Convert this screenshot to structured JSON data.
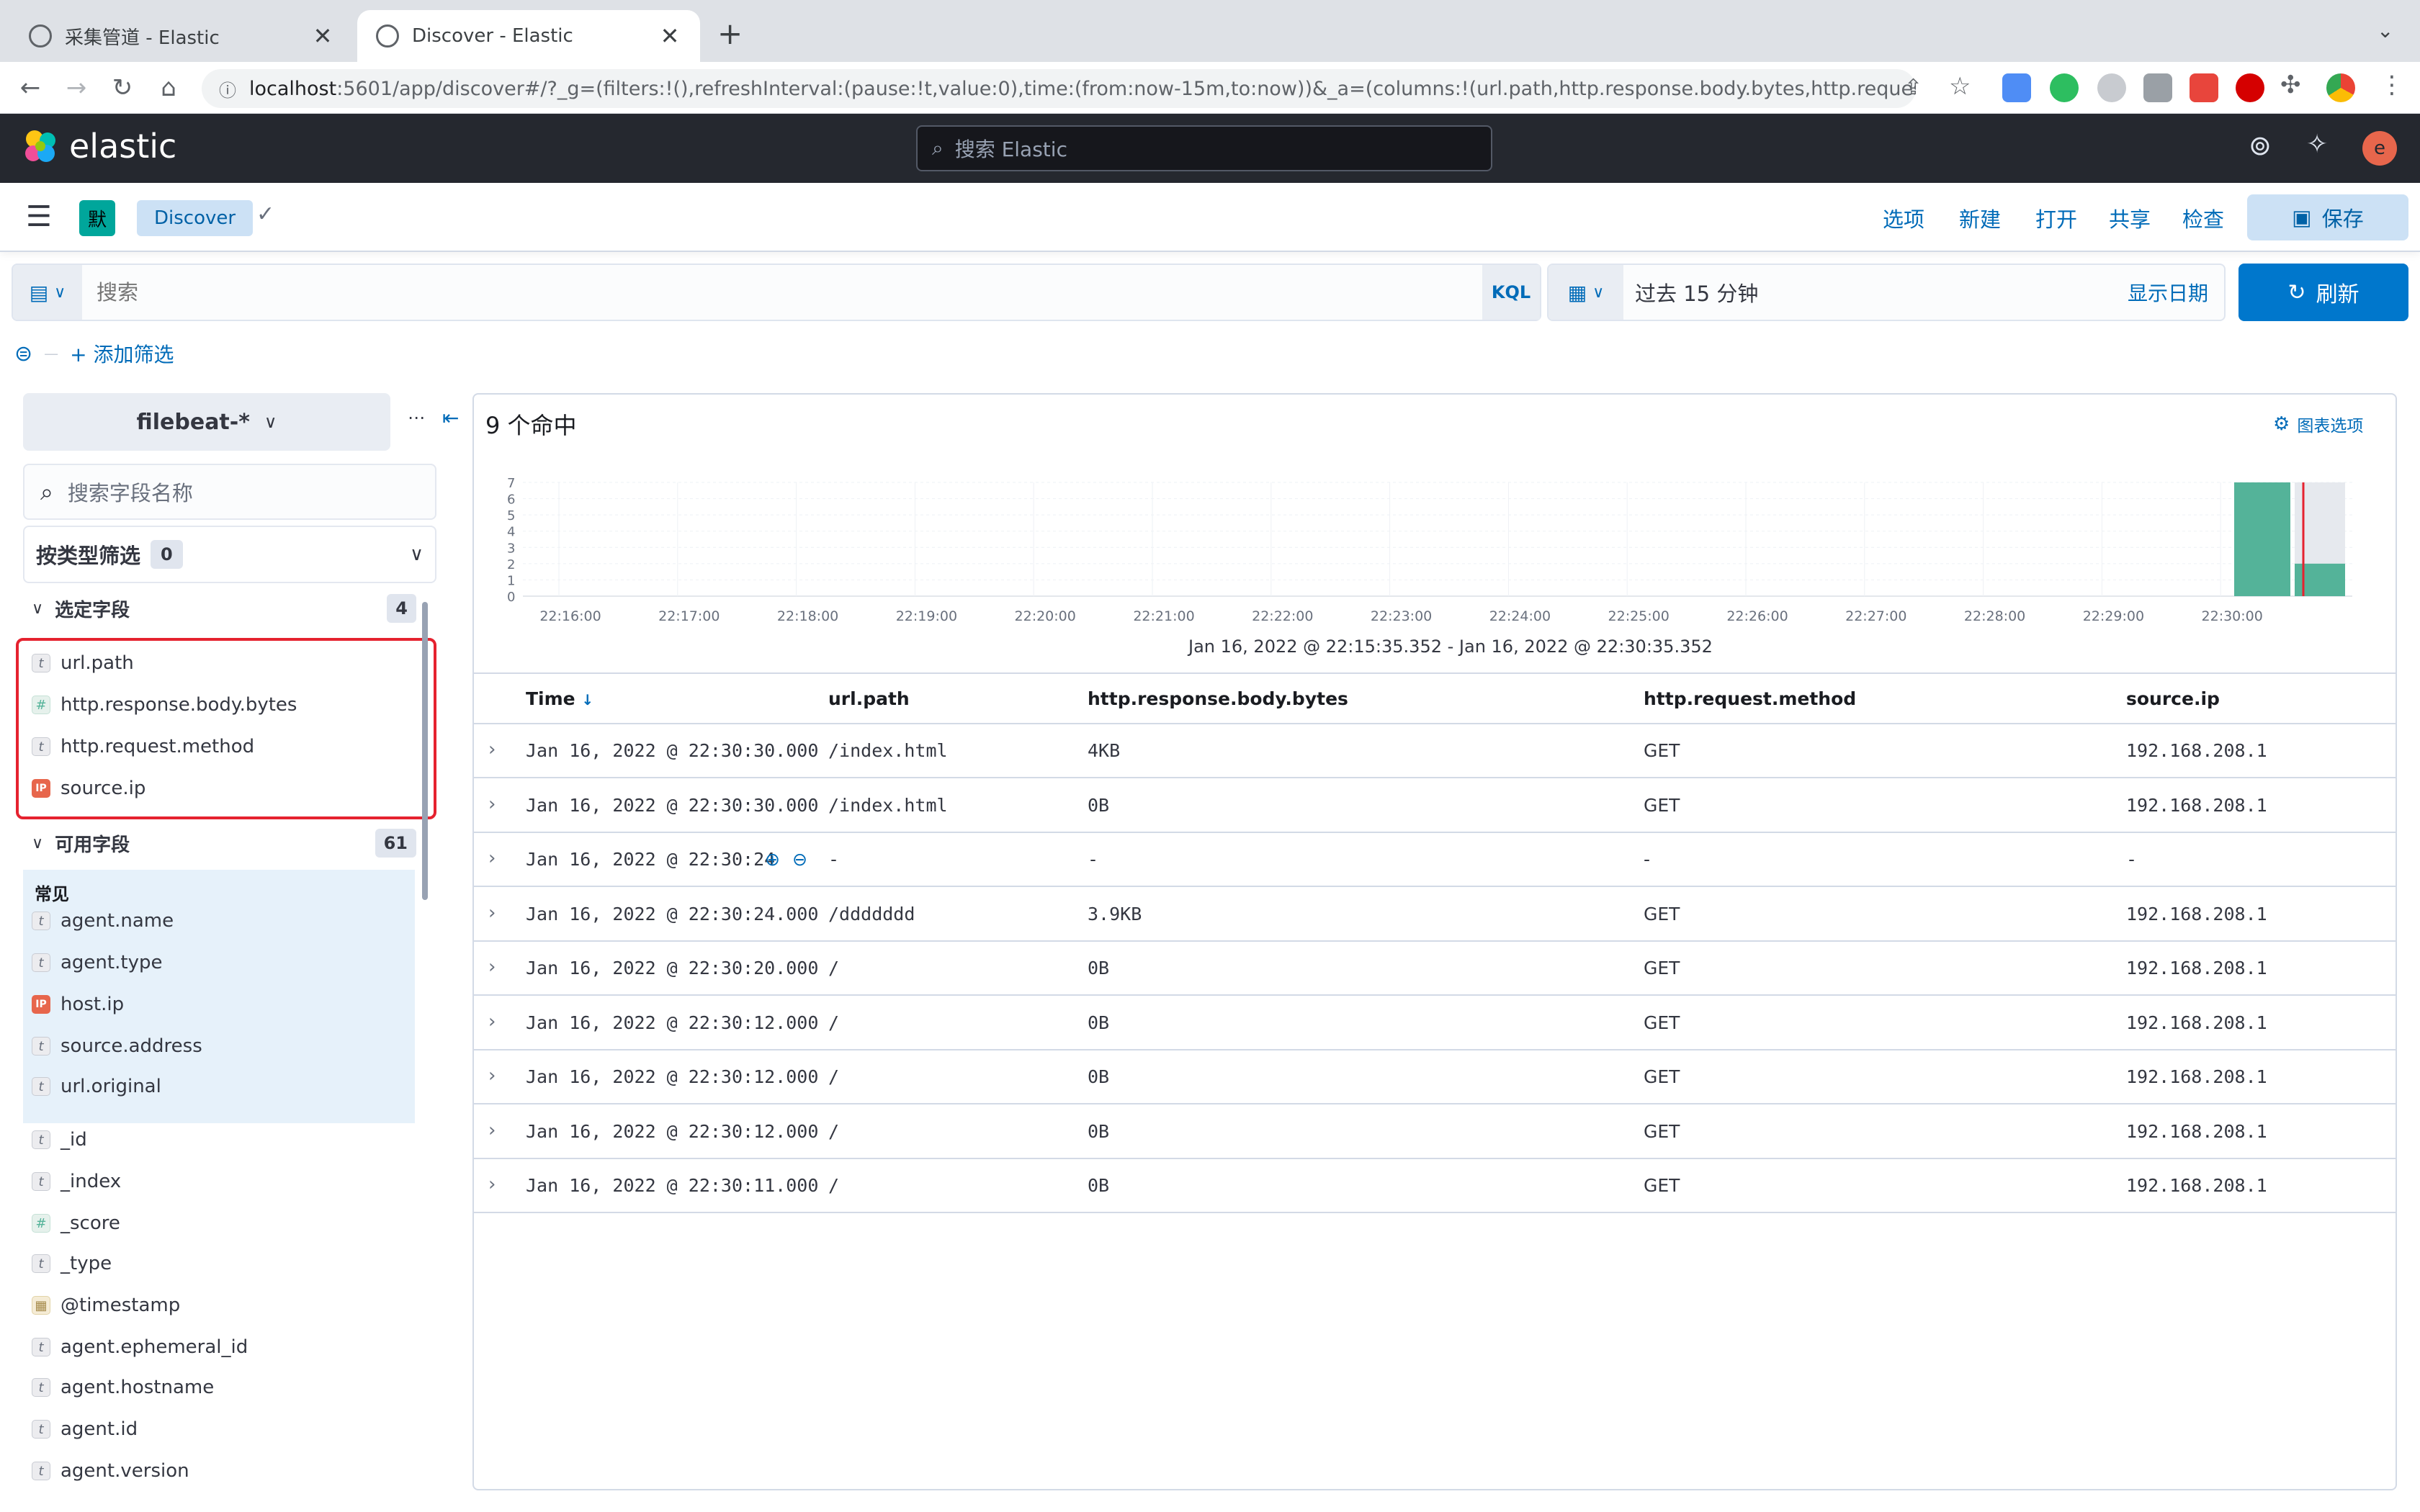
{
  "browser": {
    "tabs": [
      {
        "title": "采集管道 - Elastic",
        "active": false
      },
      {
        "title": "Discover - Elastic",
        "active": true
      }
    ],
    "url_host": "localhost",
    "url_rest": ":5601/app/discover#/?_g=(filters:!(),refreshInterval:(pause:!t,value:0),time:(from:now-15m,to:now))&_a=(columns:!(url.path,http.response.body.bytes,http.reques..."
  },
  "kibana": {
    "logo_text": "elastic",
    "search_placeholder": "搜索 Elastic",
    "avatar_letter": "e"
  },
  "toolbar": {
    "space_letter": "默",
    "breadcrumb": "Discover",
    "links": [
      "选项",
      "新建",
      "打开",
      "共享",
      "检查"
    ],
    "save_label": "保存"
  },
  "query": {
    "placeholder": "搜索",
    "language": "KQL",
    "time_label": "过去 15 分钟",
    "show_dates": "显示日期",
    "refresh_label": "刷新",
    "add_filter": "+ 添加筛选"
  },
  "sidebar": {
    "index_pattern": "filebeat-*",
    "field_search_placeholder": "搜索字段名称",
    "type_filter_label": "按类型筛选",
    "type_filter_count": "0",
    "selected_title": "选定字段",
    "selected_count": "4",
    "selected_fields": [
      {
        "name": "url.path",
        "type": "t"
      },
      {
        "name": "http.response.body.bytes",
        "type": "#"
      },
      {
        "name": "http.request.method",
        "type": "t"
      },
      {
        "name": "source.ip",
        "type": "IP"
      }
    ],
    "available_title": "可用字段",
    "available_count": "61",
    "common_title": "常见",
    "common_fields": [
      {
        "name": "agent.name",
        "type": "t"
      },
      {
        "name": "agent.type",
        "type": "t"
      },
      {
        "name": "host.ip",
        "type": "IP"
      },
      {
        "name": "source.address",
        "type": "t"
      },
      {
        "name": "url.original",
        "type": "t"
      }
    ],
    "other_fields": [
      {
        "name": "_id",
        "type": "t"
      },
      {
        "name": "_index",
        "type": "t"
      },
      {
        "name": "_score",
        "type": "#"
      },
      {
        "name": "_type",
        "type": "t"
      },
      {
        "name": "@timestamp",
        "type": "date"
      },
      {
        "name": "agent.ephemeral_id",
        "type": "t"
      },
      {
        "name": "agent.hostname",
        "type": "t"
      },
      {
        "name": "agent.id",
        "type": "t"
      },
      {
        "name": "agent.version",
        "type": "t"
      }
    ]
  },
  "results": {
    "hits_label": "9 个命中",
    "chart_options_label": "图表选项",
    "time_range": "Jan 16, 2022 @ 22:15:35.352 - Jan 16, 2022 @ 22:30:35.352",
    "columns": [
      "Time",
      "url.path",
      "http.response.body.bytes",
      "http.request.method",
      "source.ip"
    ],
    "rows": [
      [
        "Jan 16, 2022 @ 22:30:30.000",
        "/index.html",
        "4KB",
        "GET",
        "192.168.208.1"
      ],
      [
        "Jan 16, 2022 @ 22:30:30.000",
        "/index.html",
        "0B",
        "GET",
        "192.168.208.1"
      ],
      [
        "Jan 16, 2022 @ 22:30:24",
        "-",
        "-",
        "-",
        "-"
      ],
      [
        "Jan 16, 2022 @ 22:30:24.000",
        "/ddddddd",
        "3.9KB",
        "GET",
        "192.168.208.1"
      ],
      [
        "Jan 16, 2022 @ 22:30:20.000",
        "/",
        "0B",
        "GET",
        "192.168.208.1"
      ],
      [
        "Jan 16, 2022 @ 22:30:12.000",
        "/",
        "0B",
        "GET",
        "192.168.208.1"
      ],
      [
        "Jan 16, 2022 @ 22:30:12.000",
        "/",
        "0B",
        "GET",
        "192.168.208.1"
      ],
      [
        "Jan 16, 2022 @ 22:30:12.000",
        "/",
        "0B",
        "GET",
        "192.168.208.1"
      ],
      [
        "Jan 16, 2022 @ 22:30:11.000",
        "/",
        "0B",
        "GET",
        "192.168.208.1"
      ]
    ]
  },
  "chart_data": {
    "type": "bar",
    "x_ticks": [
      "22:16:00",
      "22:17:00",
      "22:18:00",
      "22:19:00",
      "22:20:00",
      "22:21:00",
      "22:22:00",
      "22:23:00",
      "22:24:00",
      "22:25:00",
      "22:26:00",
      "22:27:00",
      "22:28:00",
      "22:29:00",
      "22:30:00"
    ],
    "y_ticks": [
      0,
      1,
      2,
      3,
      4,
      5,
      6,
      7
    ],
    "ylim": [
      0,
      7
    ],
    "bars": [
      {
        "bucket": "22:30:00",
        "value": 7
      },
      {
        "bucket": "22:30:30",
        "value": 2
      }
    ],
    "bar_color": "#54b399",
    "now_marker_color": "#e5222f"
  }
}
